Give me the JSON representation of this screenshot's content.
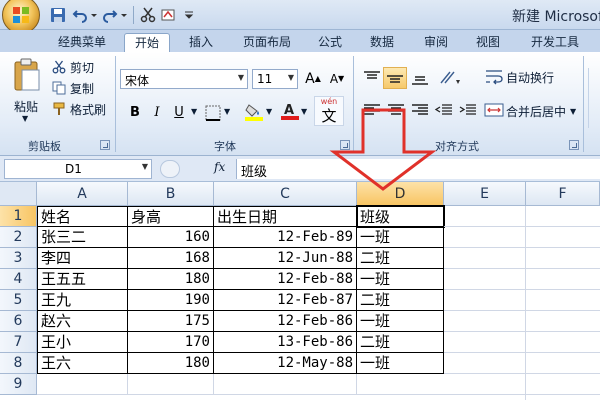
{
  "title": "新建 Microsoft",
  "tabs": [
    "经典菜单",
    "开始",
    "插入",
    "页面布局",
    "公式",
    "数据",
    "审阅",
    "视图",
    "开发工具"
  ],
  "active_tab": "开始",
  "clipboard": {
    "paste": "粘贴",
    "cut": "剪切",
    "copy": "复制",
    "format_painter": "格式刷",
    "label": "剪贴板"
  },
  "font": {
    "name": "宋体",
    "size": "11",
    "bold": "B",
    "italic": "I",
    "underline": "U",
    "label": "字体",
    "wen": "wén",
    "wen_char": "文",
    "a_big": "A",
    "a_small": "A"
  },
  "alignment": {
    "wrap": "自动换行",
    "merge": "合并后居中",
    "label": "对齐方式"
  },
  "formula_bar": {
    "name_box": "D1",
    "fx": "fx",
    "content": "班级"
  },
  "columns": [
    "A",
    "B",
    "C",
    "D",
    "E",
    "F"
  ],
  "rows": [
    "1",
    "2",
    "3",
    "4",
    "5",
    "6",
    "7",
    "8",
    "9"
  ],
  "table": {
    "headers": [
      "姓名",
      "身高",
      "出生日期",
      "班级"
    ],
    "rows": [
      [
        "张三二",
        "160",
        "12-Feb-89",
        "一班"
      ],
      [
        "李四",
        "168",
        "12-Jun-88",
        "二班"
      ],
      [
        "王五五",
        "180",
        "12-Feb-88",
        "一班"
      ],
      [
        "王九",
        "190",
        "12-Feb-87",
        "二班"
      ],
      [
        "赵六",
        "175",
        "12-Feb-86",
        "一班"
      ],
      [
        "王小",
        "170",
        "13-Feb-86",
        "二班"
      ],
      [
        "王六",
        "180",
        "12-May-88",
        "一班"
      ]
    ]
  },
  "colors": {
    "accent": "#f8c563",
    "arrow": "#e0312a",
    "ribbon": "#dfe8f5"
  }
}
